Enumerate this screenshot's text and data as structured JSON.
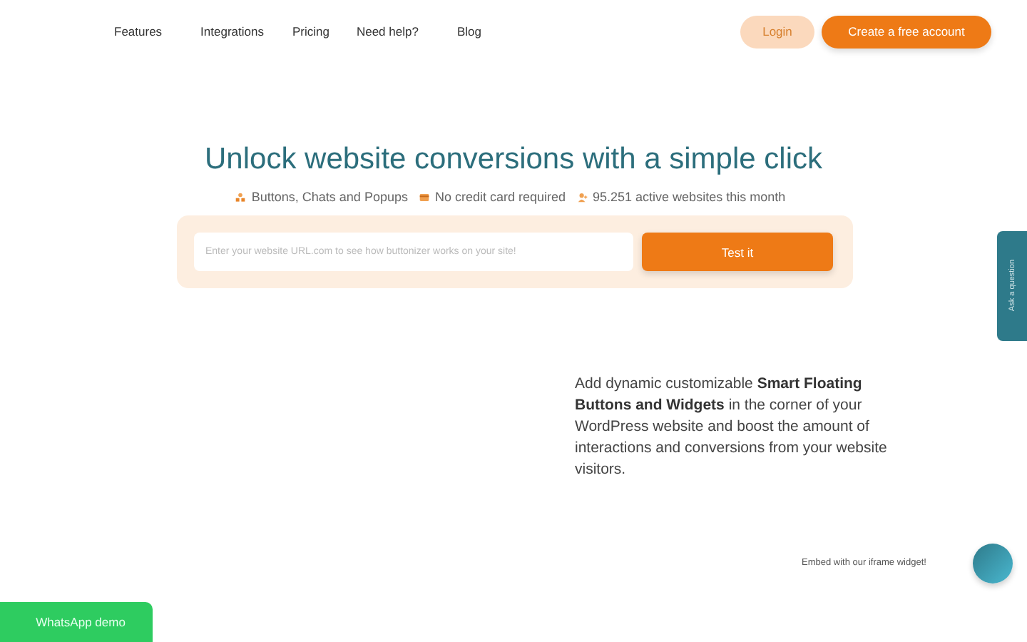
{
  "nav": {
    "links": [
      "Features",
      "Integrations",
      "Pricing",
      "Need help?",
      "Blog"
    ],
    "login": "Login",
    "signup": "Create a free account"
  },
  "hero": {
    "title": "Unlock website conversions with a simple click",
    "features": [
      {
        "kind": "shapes",
        "text": "Buttons, Chats and Popups"
      },
      {
        "kind": "card",
        "text": "No credit card required"
      },
      {
        "kind": "users",
        "text": "95.251 active websites this month"
      }
    ],
    "url_field": {
      "placeholder": "Enter your website URL.com to see how buttonizer works on your site!"
    },
    "test_button": "Test it"
  },
  "intro": "Add dynamic customizable **Smart Floating Buttons and Widgets** in the corner of your WordPress website and boost the amount of interactions and conversions from your website visitors.",
  "side_tab": "Ask a question",
  "embed_label": "Embed with our iframe widget!",
  "whatsapp": "WhatsApp demo"
}
